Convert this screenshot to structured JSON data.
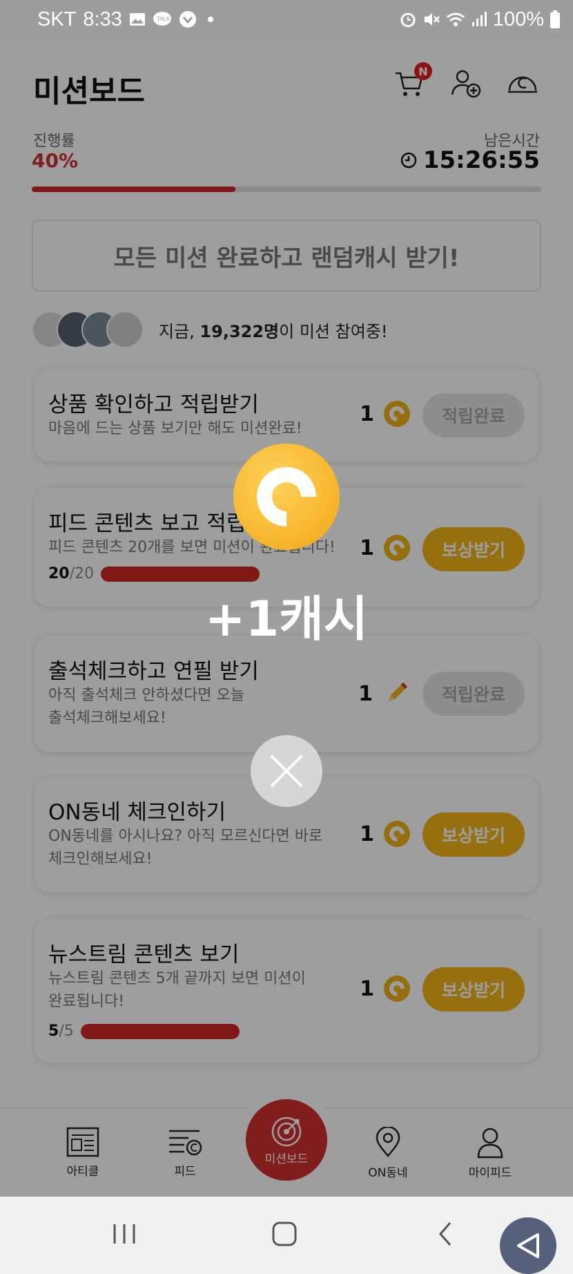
{
  "status_bar": {
    "carrier": "SKT",
    "time": "8:33",
    "battery": "100%"
  },
  "header": {
    "title": "미션보드",
    "cart_badge": "N"
  },
  "progress": {
    "label": "진행률",
    "value": "40%",
    "fraction": 0.4
  },
  "remaining": {
    "label": "남은시간",
    "time": "15:26:55"
  },
  "all_missions_button": "모든 미션 완료하고 랜덤캐시 받기!",
  "participants": {
    "prefix": "지금, ",
    "count": "19,322명",
    "suffix": "이 미션 참여중!"
  },
  "missions": [
    {
      "title": "상품 확인하고 적립받기",
      "desc": "마음에 드는 상품 보기만 해도 미션완료!",
      "reward": "1",
      "reward_icon": "coin-icon",
      "button": "적립완료",
      "state": "done"
    },
    {
      "title": "피드 콘텐츠 보고 적립받기",
      "desc": "피드 콘텐츠 20개를 보면 미션이 완료됩니다!",
      "reward": "1",
      "reward_icon": "coin-icon",
      "button": "보상받기",
      "state": "claim",
      "progress_done": "20",
      "progress_total": "/20",
      "progress_fraction": 1.0
    },
    {
      "title": "출석체크하고 연필 받기",
      "desc": "아직 출석체크 안하셨다면 오늘 출석체크해보세요!",
      "reward": "1",
      "reward_icon": "pencil-icon",
      "button": "적립완료",
      "state": "done"
    },
    {
      "title": "ON동네 체크인하기",
      "desc": "ON동네를 아시나요? 아직 모르신다면 바로 체크인해보세요!",
      "reward": "1",
      "reward_icon": "coin-icon",
      "button": "보상받기",
      "state": "claim"
    },
    {
      "title": "뉴스트림 콘텐츠 보기",
      "desc": "뉴스트림 콘텐츠 5개 끝까지 보면 미션이 완료됩니다!",
      "reward": "1",
      "reward_icon": "coin-icon",
      "button": "보상받기",
      "state": "claim",
      "progress_done": "5",
      "progress_total": "/5",
      "progress_fraction": 1.0
    }
  ],
  "bottom_nav": [
    {
      "label": "아티클",
      "icon": "article-icon"
    },
    {
      "label": "피드",
      "icon": "feed-icon"
    },
    {
      "label": "미션보드",
      "icon": "target-icon"
    },
    {
      "label": "ON동네",
      "icon": "location-pin-icon"
    },
    {
      "label": "마이피드",
      "icon": "person-icon"
    }
  ],
  "overlay": {
    "reward_text": "+1캐시"
  },
  "colors": {
    "accent_red": "#d03030",
    "coin_gold": "#f2b418"
  }
}
